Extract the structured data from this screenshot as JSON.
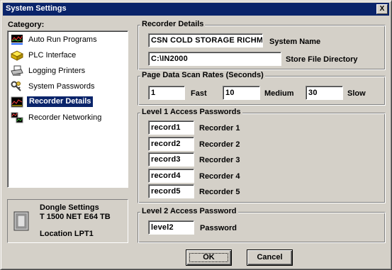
{
  "window": {
    "title": "System Settings",
    "close_label": "X"
  },
  "category": {
    "heading": "Category:",
    "items": [
      {
        "label": "Auto Run Programs",
        "icon": "chart-icon",
        "selected": false
      },
      {
        "label": "PLC Interface",
        "icon": "plc-icon",
        "selected": false
      },
      {
        "label": "Logging Printers",
        "icon": "printer-icon",
        "selected": false
      },
      {
        "label": "System Passwords",
        "icon": "keys-icon",
        "selected": false
      },
      {
        "label": "Recorder Details",
        "icon": "recorder-icon",
        "selected": true
      },
      {
        "label": "Recorder Networking",
        "icon": "network-icon",
        "selected": false
      }
    ]
  },
  "dongle": {
    "line1": "Dongle Settings",
    "line2": "T 1500 NET E64 TB",
    "line3": "Location LPT1"
  },
  "recorder_details": {
    "title": "Recorder Details",
    "system_name_value": "CSN COLD STORAGE RICHMO",
    "system_name_label": "System Name",
    "store_dir_value": "C:\\IN2000",
    "store_dir_label": "Store File Directory"
  },
  "scan_rates": {
    "title": "Page Data Scan Rates (Seconds)",
    "fast_value": "1",
    "fast_label": "Fast",
    "medium_value": "10",
    "medium_label": "Medium",
    "slow_value": "30",
    "slow_label": "Slow"
  },
  "level1": {
    "title": "Level 1 Access Passwords",
    "rows": [
      {
        "value": "record1",
        "label": "Recorder 1"
      },
      {
        "value": "record2",
        "label": "Recorder 2"
      },
      {
        "value": "record3",
        "label": "Recorder 3"
      },
      {
        "value": "record4",
        "label": "Recorder 4"
      },
      {
        "value": "record5",
        "label": "Recorder 5"
      }
    ]
  },
  "level2": {
    "title": "Level 2 Access Password",
    "value": "level2",
    "label": "Password"
  },
  "buttons": {
    "ok": "OK",
    "cancel": "Cancel"
  }
}
